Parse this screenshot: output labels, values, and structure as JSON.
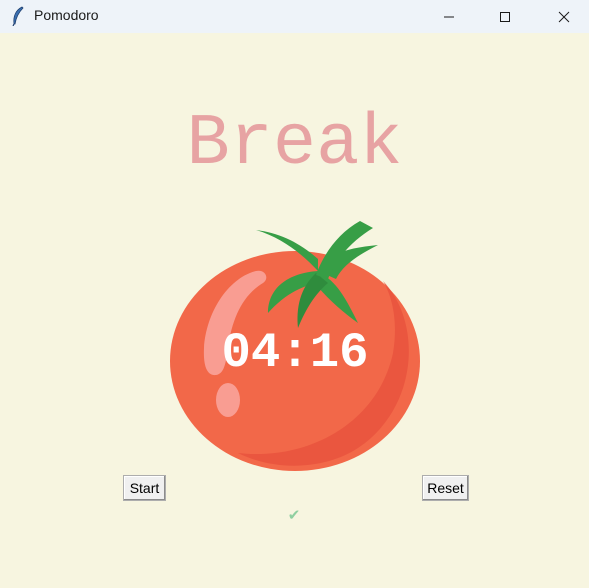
{
  "window": {
    "title": "Pomodoro",
    "icon": "feather-icon",
    "controls": [
      "minimize-icon",
      "maximize-icon",
      "close-icon"
    ]
  },
  "main": {
    "heading": "Break",
    "timer": "04:16",
    "start_label": "Start",
    "reset_label": "Reset",
    "checkmarks": "✔"
  },
  "colors": {
    "background": "#f7f5e0",
    "heading": "#e7a3a3",
    "tomato": "#f26849",
    "leaf": "#379e46",
    "checkmark": "#8fcfa0"
  }
}
